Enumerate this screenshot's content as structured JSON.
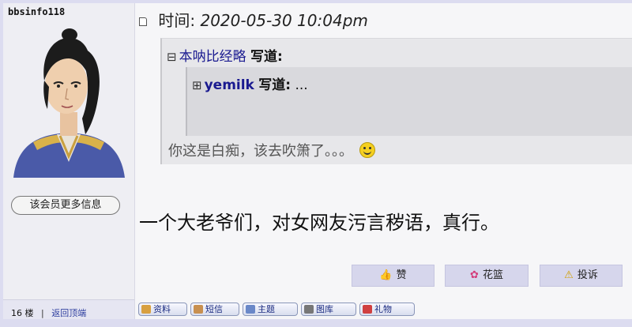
{
  "user": {
    "name": "bbsinfo118",
    "more_info_label": "该会员更多信息"
  },
  "floor": {
    "label": "16 楼",
    "separator": "|",
    "back_to_top": "返回顶端"
  },
  "post": {
    "time_label": "时间:",
    "time_value": "2020-05-30 10:04pm",
    "quote": {
      "toggle": "⊟",
      "author": "本呐比经略",
      "wrote": "写道:",
      "inner": {
        "toggle": "⊞",
        "author": "yemilk",
        "wrote": "写道:",
        "ellipsis": "..."
      },
      "text": "你这是白痴，该去吹箫了。。。"
    },
    "body": "一个大老爷们，对女网友污言秽语，真行。"
  },
  "actions": {
    "like": "赞",
    "flower": "花篮",
    "report": "投诉"
  },
  "toolbar": {
    "profile": "资料",
    "message": "短信",
    "topics": "主题",
    "gallery": "图库",
    "gift": "礼物"
  },
  "icons": {
    "like": "thumbs-up-icon",
    "flower": "flower-icon",
    "report": "warning-icon",
    "time": "document-icon",
    "smiley": "smiley-icon"
  },
  "colors": {
    "link": "#1a1a90",
    "action_button_bg": "#d6d6ec",
    "toolbar_text": "#1a2a80"
  }
}
